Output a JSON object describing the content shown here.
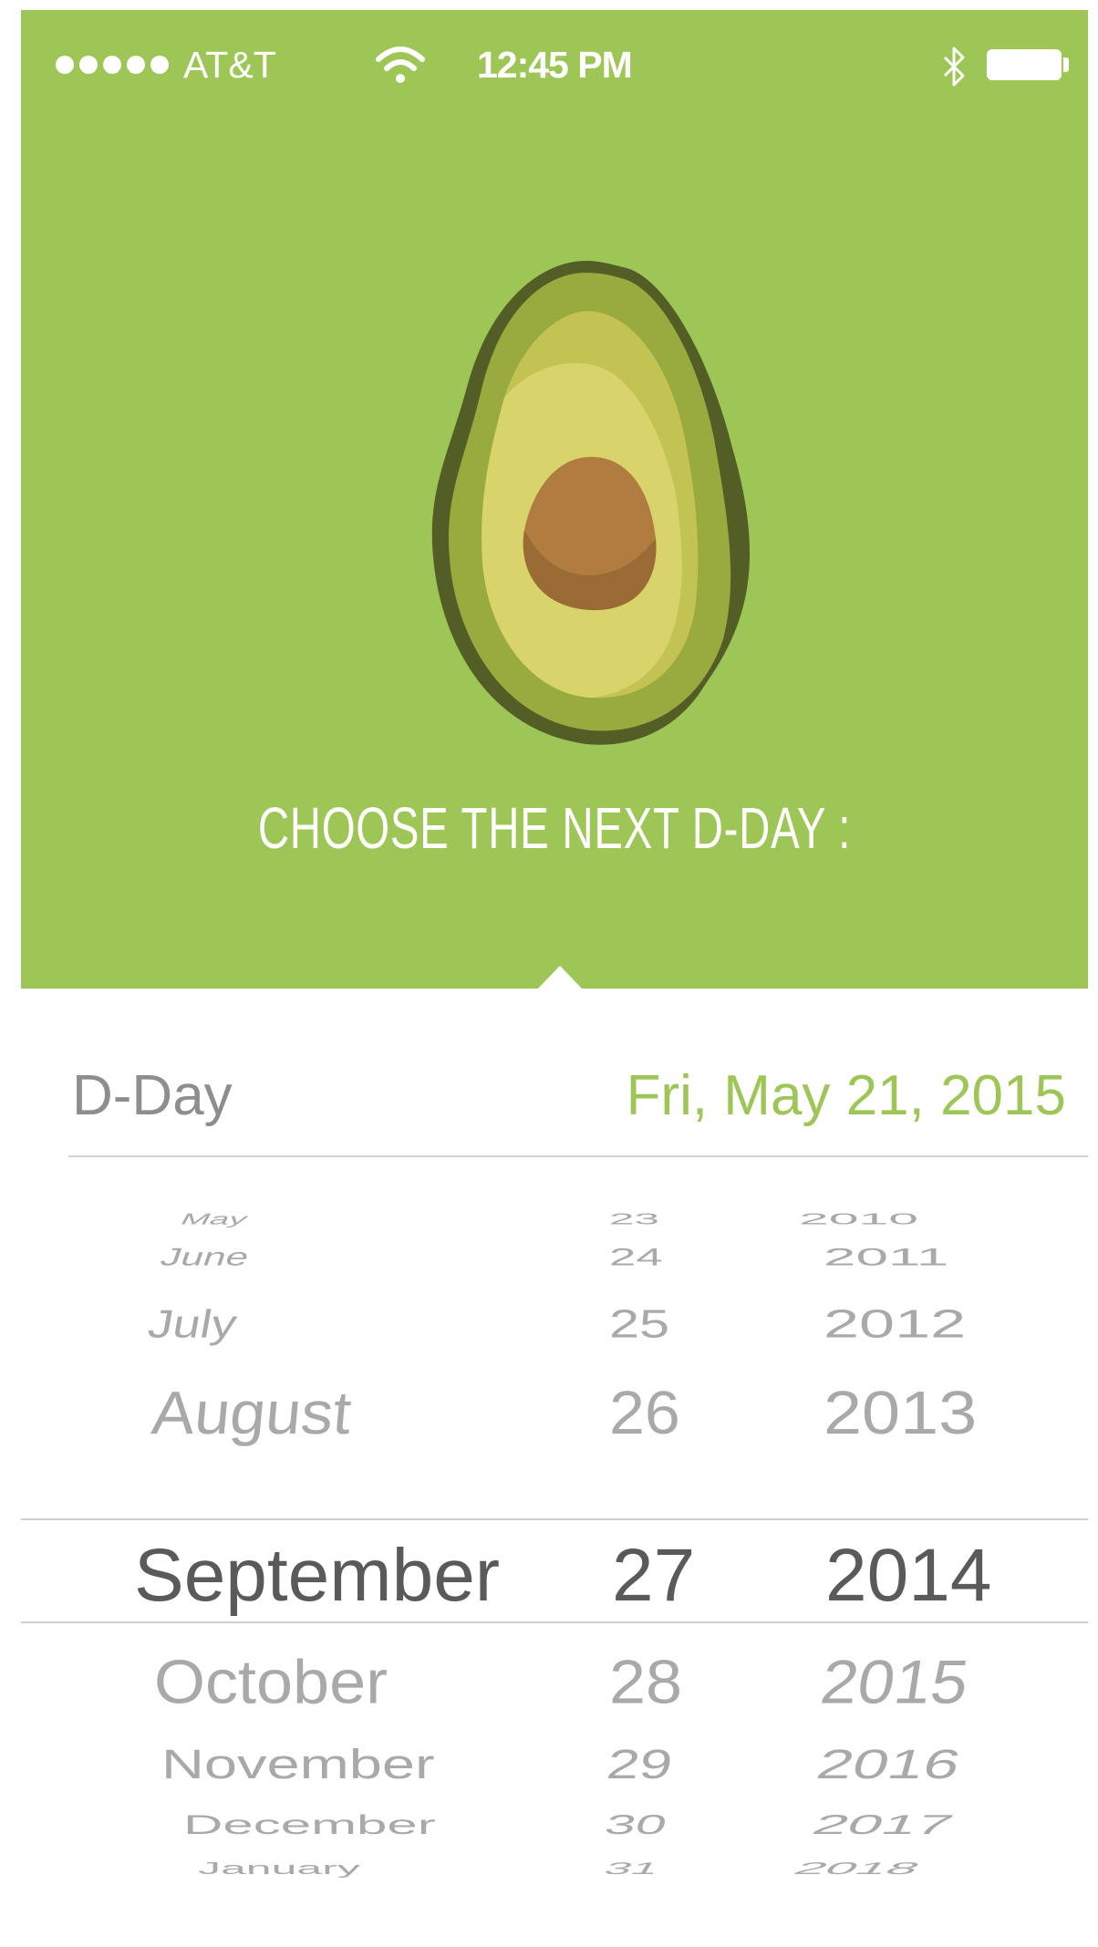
{
  "status_bar": {
    "carrier": "AT&T",
    "time": "12:45 PM",
    "signal_bars": 5,
    "battery_level": 1.0
  },
  "header": {
    "prompt": "CHOOSE THE NEXT D-DAY :",
    "illustration": "avocado-icon"
  },
  "dday": {
    "label": "D-Day",
    "value": "Fri, May 21, 2015"
  },
  "picker": {
    "months": [
      "May",
      "June",
      "July",
      "August",
      "September",
      "October",
      "November",
      "December",
      "January"
    ],
    "days": [
      "23",
      "24",
      "25",
      "26",
      "27",
      "28",
      "29",
      "30",
      "31"
    ],
    "years": [
      "2010",
      "2011",
      "2012",
      "2013",
      "2014",
      "2015",
      "2016",
      "2017",
      "2018"
    ],
    "selected": {
      "month": "September",
      "day": "27",
      "year": "2014"
    }
  },
  "colors": {
    "accent": "#9ec656",
    "header_bg": "#9ec656",
    "selected_text": "#5a5a5a",
    "dim_text": "#a9a9a9",
    "label_text": "#8e8e8e"
  }
}
